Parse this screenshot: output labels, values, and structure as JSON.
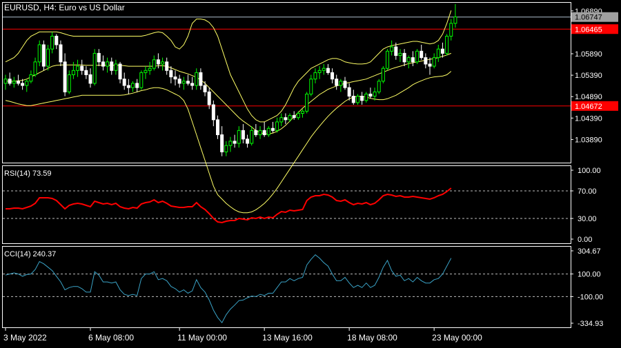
{
  "header": {
    "symbol_info": "EURUSD, H4:  Euro vs US Dollar"
  },
  "panels": {
    "rsi_label": "RSI(14) 73.59",
    "cci_label": "CCI(14) 240.37"
  },
  "price_axis": {
    "ticks": [
      "1.06890",
      "1.05890",
      "1.05390",
      "1.04890",
      "1.04390",
      "1.03890"
    ],
    "tick_values": [
      1.0689,
      1.0589,
      1.0539,
      1.0489,
      1.0439,
      1.0389
    ],
    "range": [
      1.0335,
      1.0708
    ],
    "current_price_label": "1.06747",
    "current_price": 1.06747,
    "line1_label": "1.06465",
    "line1_value": 1.06465,
    "line2_label": "1.04672",
    "line2_value": 1.04672
  },
  "rsi_axis": {
    "ticks": [
      "100.00",
      "70.00",
      "30.00",
      "0.00"
    ],
    "tick_values": [
      100,
      70,
      30,
      0
    ],
    "dashed_levels": [
      70,
      30
    ]
  },
  "cci_axis": {
    "ticks": [
      "304.67",
      "100.00",
      "-100.00",
      "-334.93"
    ],
    "tick_values": [
      304.67,
      100,
      -100,
      -334.93
    ],
    "dashed_levels": [
      100,
      -100
    ]
  },
  "time_axis": {
    "labels": [
      "3 May 2022",
      "6 May 08:00",
      "11 May 00:00",
      "13 May 16:00",
      "18 May 08:00",
      "23 May 00:00"
    ],
    "label_bar_index": [
      0,
      20,
      41,
      61,
      81,
      101
    ]
  },
  "colors": {
    "background": "#000000",
    "grid_border": "#ffffff",
    "bull_candle": "#00ff00",
    "bear_candle": "#ffffff",
    "bollinger": "#ffff66",
    "rsi_line": "#ff0000",
    "cci_line": "#3aa3c7",
    "hline": "#ff0000",
    "price_tag": "#ff0000",
    "current_tag": "#a0a0a0",
    "bid_line": "#b0c0d0"
  },
  "chart_data": {
    "type": "candlestick",
    "symbol": "EURUSD",
    "timeframe": "H4",
    "candles": [
      [
        1.052,
        1.054,
        1.0505,
        1.053
      ],
      [
        1.053,
        1.0545,
        1.0515,
        1.052
      ],
      [
        1.052,
        1.0535,
        1.051,
        1.0525
      ],
      [
        1.0525,
        1.054,
        1.0515,
        1.052
      ],
      [
        1.052,
        1.053,
        1.0505,
        1.0515
      ],
      [
        1.0515,
        1.053,
        1.05,
        1.0525
      ],
      [
        1.0525,
        1.055,
        1.052,
        1.054
      ],
      [
        1.054,
        1.058,
        1.0535,
        1.057
      ],
      [
        1.057,
        1.062,
        1.056,
        1.061
      ],
      [
        1.061,
        1.062,
        1.055,
        1.056
      ],
      [
        1.056,
        1.061,
        1.055,
        1.06
      ],
      [
        1.06,
        1.064,
        1.059,
        1.063
      ],
      [
        1.063,
        1.0635,
        1.06,
        1.061
      ],
      [
        1.061,
        1.062,
        1.056,
        1.057
      ],
      [
        1.057,
        1.059,
        1.049,
        1.05
      ],
      [
        1.05,
        1.055,
        1.0495,
        1.054
      ],
      [
        1.054,
        1.057,
        1.053,
        1.055
      ],
      [
        1.055,
        1.0575,
        1.0535,
        1.056
      ],
      [
        1.056,
        1.0575,
        1.054,
        1.055
      ],
      [
        1.055,
        1.056,
        1.053,
        1.054
      ],
      [
        1.054,
        1.0555,
        1.051,
        1.052
      ],
      [
        1.052,
        1.06,
        1.0515,
        1.059
      ],
      [
        1.059,
        1.06,
        1.056,
        1.057
      ],
      [
        1.057,
        1.0585,
        1.055,
        1.056
      ],
      [
        1.056,
        1.058,
        1.0545,
        1.057
      ],
      [
        1.057,
        1.058,
        1.054,
        1.055
      ],
      [
        1.055,
        1.0575,
        1.054,
        1.0565
      ],
      [
        1.0565,
        1.057,
        1.052,
        1.053
      ],
      [
        1.053,
        1.0545,
        1.0505,
        1.0515
      ],
      [
        1.0515,
        1.053,
        1.0495,
        1.051
      ],
      [
        1.051,
        1.0525,
        1.05,
        1.052
      ],
      [
        1.052,
        1.053,
        1.05,
        1.051
      ],
      [
        1.051,
        1.055,
        1.0505,
        1.0545
      ],
      [
        1.0545,
        1.056,
        1.053,
        1.055
      ],
      [
        1.055,
        1.057,
        1.054,
        1.0555
      ],
      [
        1.0555,
        1.0585,
        1.055,
        1.0575
      ],
      [
        1.0575,
        1.059,
        1.0555,
        1.0565
      ],
      [
        1.0565,
        1.058,
        1.055,
        1.057
      ],
      [
        1.057,
        1.058,
        1.054,
        1.055
      ],
      [
        1.055,
        1.056,
        1.052,
        1.0535
      ],
      [
        1.0535,
        1.055,
        1.0515,
        1.053
      ],
      [
        1.053,
        1.054,
        1.051,
        1.052
      ],
      [
        1.052,
        1.0535,
        1.0505,
        1.0525
      ],
      [
        1.0525,
        1.054,
        1.0515,
        1.052
      ],
      [
        1.052,
        1.0535,
        1.0505,
        1.0515
      ],
      [
        1.0515,
        1.0555,
        1.0505,
        1.0545
      ],
      [
        1.0545,
        1.0555,
        1.0505,
        1.0515
      ],
      [
        1.0515,
        1.0525,
        1.049,
        1.05
      ],
      [
        1.05,
        1.051,
        1.046,
        1.047
      ],
      [
        1.047,
        1.048,
        1.042,
        1.0435
      ],
      [
        1.0435,
        1.0445,
        1.039,
        1.04
      ],
      [
        1.04,
        1.042,
        1.035,
        1.036
      ],
      [
        1.036,
        1.0385,
        1.035,
        1.0375
      ],
      [
        1.0375,
        1.0395,
        1.036,
        1.0385
      ],
      [
        1.0385,
        1.04,
        1.037,
        1.038
      ],
      [
        1.038,
        1.042,
        1.037,
        1.041
      ],
      [
        1.041,
        1.0425,
        1.038,
        1.039
      ],
      [
        1.039,
        1.04,
        1.037,
        1.038
      ],
      [
        1.038,
        1.042,
        1.0375,
        1.041
      ],
      [
        1.041,
        1.0425,
        1.0395,
        1.04
      ],
      [
        1.04,
        1.042,
        1.039,
        1.041
      ],
      [
        1.041,
        1.043,
        1.0395,
        1.04
      ],
      [
        1.04,
        1.042,
        1.0395,
        1.0415
      ],
      [
        1.0415,
        1.043,
        1.0405,
        1.041
      ],
      [
        1.041,
        1.044,
        1.0405,
        1.043
      ],
      [
        1.043,
        1.045,
        1.042,
        1.044
      ],
      [
        1.044,
        1.045,
        1.0425,
        1.0435
      ],
      [
        1.0435,
        1.045,
        1.043,
        1.0445
      ],
      [
        1.0445,
        1.0455,
        1.0435,
        1.044
      ],
      [
        1.044,
        1.0455,
        1.0435,
        1.045
      ],
      [
        1.045,
        1.046,
        1.044,
        1.0455
      ],
      [
        1.0455,
        1.05,
        1.045,
        1.0495
      ],
      [
        1.0495,
        1.054,
        1.049,
        1.053
      ],
      [
        1.053,
        1.0555,
        1.052,
        1.0545
      ],
      [
        1.0545,
        1.056,
        1.053,
        1.055
      ],
      [
        1.055,
        1.0565,
        1.054,
        1.0555
      ],
      [
        1.0555,
        1.0565,
        1.054,
        1.0545
      ],
      [
        1.0545,
        1.0555,
        1.052,
        1.053
      ],
      [
        1.053,
        1.054,
        1.0505,
        1.0515
      ],
      [
        1.0515,
        1.053,
        1.05,
        1.0525
      ],
      [
        1.0525,
        1.0535,
        1.0505,
        1.051
      ],
      [
        1.051,
        1.052,
        1.048,
        1.049
      ],
      [
        1.049,
        1.0505,
        1.047,
        1.0475
      ],
      [
        1.0475,
        1.0495,
        1.047,
        1.049
      ],
      [
        1.049,
        1.05,
        1.047,
        1.048
      ],
      [
        1.048,
        1.05,
        1.0475,
        1.0495
      ],
      [
        1.0495,
        1.051,
        1.0485,
        1.049
      ],
      [
        1.049,
        1.051,
        1.048,
        1.05
      ],
      [
        1.05,
        1.053,
        1.0495,
        1.0525
      ],
      [
        1.0525,
        1.056,
        1.052,
        1.0555
      ],
      [
        1.0555,
        1.06,
        1.055,
        1.0595
      ],
      [
        1.0595,
        1.062,
        1.0585,
        1.0605
      ],
      [
        1.0605,
        1.0615,
        1.0575,
        1.0585
      ],
      [
        1.0585,
        1.06,
        1.057,
        1.059
      ],
      [
        1.059,
        1.06,
        1.056,
        1.057
      ],
      [
        1.057,
        1.0585,
        1.0555,
        1.058
      ],
      [
        1.058,
        1.0595,
        1.056,
        1.057
      ],
      [
        1.057,
        1.06,
        1.0565,
        1.0595
      ],
      [
        1.0595,
        1.061,
        1.0575,
        1.058
      ],
      [
        1.058,
        1.059,
        1.0555,
        1.0565
      ],
      [
        1.0565,
        1.058,
        1.054,
        1.056
      ],
      [
        1.056,
        1.059,
        1.0555,
        1.058
      ],
      [
        1.058,
        1.061,
        1.057,
        1.06
      ],
      [
        1.06,
        1.0615,
        1.058,
        1.059
      ],
      [
        1.059,
        1.0635,
        1.0585,
        1.063
      ],
      [
        1.063,
        1.067,
        1.062,
        1.066
      ],
      [
        1.066,
        1.0705,
        1.065,
        1.0675
      ]
    ],
    "bollinger": {
      "upper": [
        1.057,
        1.0575,
        1.058,
        1.059,
        1.0605,
        1.062,
        1.063,
        1.0635,
        1.064,
        1.064,
        1.064,
        1.064,
        1.064,
        1.0638,
        1.0635,
        1.0632,
        1.063,
        1.063,
        1.063,
        1.063,
        1.063,
        1.063,
        1.063,
        1.063,
        1.063,
        1.063,
        1.063,
        1.063,
        1.063,
        1.063,
        1.063,
        1.063,
        1.063,
        1.0632,
        1.0635,
        1.0638,
        1.064,
        1.0638,
        1.063,
        1.062,
        1.0605,
        1.06,
        1.061,
        1.063,
        1.066,
        1.067,
        1.067,
        1.0668,
        1.0662,
        1.065,
        1.063,
        1.06,
        1.057,
        1.054,
        1.052,
        1.05,
        1.048,
        1.046,
        1.0445,
        1.0435,
        1.043,
        1.043,
        1.0435,
        1.044,
        1.0445,
        1.0455,
        1.047,
        1.049,
        1.051,
        1.0525,
        1.0535,
        1.0545,
        1.0555,
        1.056,
        1.0565,
        1.057,
        1.0575,
        1.0578,
        1.0578,
        1.0575,
        1.057,
        1.0568,
        1.0566,
        1.0565,
        1.0565,
        1.0566,
        1.057,
        1.058,
        1.059,
        1.06,
        1.0605,
        1.0608,
        1.061,
        1.0612,
        1.0614,
        1.0616,
        1.0618,
        1.0618,
        1.0616,
        1.0614,
        1.0612,
        1.0614,
        1.062,
        1.0635,
        1.066,
        1.069
      ],
      "middle": [
        1.0525,
        1.0525,
        1.0525,
        1.0526,
        1.0527,
        1.053,
        1.0535,
        1.054,
        1.0545,
        1.055,
        1.0555,
        1.056,
        1.0562,
        1.0563,
        1.0563,
        1.0563,
        1.0563,
        1.0563,
        1.0563,
        1.0562,
        1.0562,
        1.0562,
        1.0562,
        1.0562,
        1.0562,
        1.0562,
        1.0562,
        1.0562,
        1.0561,
        1.056,
        1.056,
        1.056,
        1.056,
        1.056,
        1.056,
        1.056,
        1.0561,
        1.0561,
        1.056,
        1.0556,
        1.0552,
        1.0548,
        1.0545,
        1.0542,
        1.0538,
        1.0534,
        1.0528,
        1.052,
        1.051,
        1.05,
        1.049,
        1.048,
        1.047,
        1.046,
        1.045,
        1.044,
        1.0432,
        1.0425,
        1.0418,
        1.041,
        1.0405,
        1.0402,
        1.0402,
        1.0404,
        1.0408,
        1.0414,
        1.0422,
        1.0432,
        1.0442,
        1.0452,
        1.0462,
        1.047,
        1.0478,
        1.0486,
        1.0494,
        1.05,
        1.0506,
        1.051,
        1.0514,
        1.0517,
        1.052,
        1.0522,
        1.0524,
        1.0526,
        1.0528,
        1.053,
        1.0534,
        1.0538,
        1.0542,
        1.0546,
        1.055,
        1.0554,
        1.0557,
        1.056,
        1.0563,
        1.0566,
        1.0568,
        1.057,
        1.0572,
        1.0574,
        1.0576,
        1.0578,
        1.058,
        1.0583,
        1.0586,
        1.059
      ],
      "lower": [
        1.048,
        1.0478,
        1.0475,
        1.0472,
        1.047,
        1.0468,
        1.0468,
        1.047,
        1.0472,
        1.0474,
        1.0476,
        1.0478,
        1.048,
        1.0482,
        1.0484,
        1.0486,
        1.0488,
        1.049,
        1.0492,
        1.0492,
        1.0492,
        1.0492,
        1.0492,
        1.0492,
        1.0492,
        1.0492,
        1.0492,
        1.0492,
        1.0493,
        1.0495,
        1.0497,
        1.05,
        1.0503,
        1.0505,
        1.0508,
        1.051,
        1.051,
        1.0508,
        1.0505,
        1.05,
        1.0495,
        1.049,
        1.048,
        1.046,
        1.043,
        1.04,
        1.037,
        1.034,
        1.031,
        1.028,
        1.026,
        1.025,
        1.024,
        1.0232,
        1.0225,
        1.022,
        1.0218,
        1.0218,
        1.022,
        1.0225,
        1.0232,
        1.024,
        1.025,
        1.0262,
        1.0275,
        1.029,
        1.0305,
        1.032,
        1.0335,
        1.035,
        1.0365,
        1.038,
        1.0395,
        1.0408,
        1.042,
        1.0432,
        1.0443,
        1.0453,
        1.0462,
        1.047,
        1.0478,
        1.0484,
        1.0488,
        1.049,
        1.049,
        1.0488,
        1.0485,
        1.0483,
        1.0482,
        1.0482,
        1.0484,
        1.0488,
        1.0492,
        1.0498,
        1.0504,
        1.051,
        1.0517,
        1.0522,
        1.0526,
        1.053,
        1.0533,
        1.0535,
        1.0536,
        1.0537,
        1.054,
        1.0548
      ]
    },
    "rsi": [
      44,
      44,
      45,
      45,
      44,
      46,
      48,
      52,
      60,
      60,
      60,
      59,
      56,
      50,
      44,
      49,
      51,
      52,
      51,
      49,
      47,
      55,
      53,
      51,
      52,
      50,
      52,
      47,
      45,
      44,
      46,
      45,
      51,
      53,
      54,
      57,
      53,
      55,
      52,
      48,
      47,
      46,
      46,
      47,
      47,
      53,
      47,
      43,
      37,
      30,
      25,
      24,
      26,
      27,
      27,
      30,
      29,
      28,
      31,
      30,
      32,
      30,
      32,
      31,
      36,
      40,
      39,
      42,
      41,
      42,
      43,
      56,
      61,
      63,
      63,
      65,
      64,
      61,
      56,
      55,
      57,
      53,
      50,
      52,
      51,
      53,
      50,
      52,
      57,
      63,
      65,
      64,
      62,
      63,
      61,
      61,
      62,
      61,
      60,
      59,
      58,
      60,
      63,
      65,
      69,
      74
    ],
    "cci": [
      90,
      100,
      110,
      100,
      80,
      95,
      100,
      140,
      210,
      190,
      160,
      130,
      80,
      30,
      -40,
      -20,
      -10,
      -10,
      -30,
      -60,
      -60,
      120,
      90,
      30,
      30,
      20,
      30,
      -40,
      -80,
      -90,
      -80,
      -90,
      60,
      100,
      100,
      120,
      50,
      60,
      40,
      -10,
      -30,
      -60,
      -40,
      -70,
      -50,
      50,
      -20,
      -60,
      -130,
      -220,
      -285,
      -330,
      -260,
      -210,
      -175,
      -135,
      -130,
      -110,
      -95,
      -100,
      -80,
      -90,
      -70,
      -70,
      -20,
      30,
      30,
      60,
      40,
      60,
      70,
      180,
      230,
      270,
      240,
      200,
      170,
      100,
      40,
      40,
      70,
      20,
      -20,
      0,
      -20,
      20,
      -20,
      0,
      70,
      160,
      220,
      130,
      80,
      90,
      40,
      60,
      30,
      70,
      40,
      20,
      20,
      50,
      60,
      100,
      170,
      240
    ]
  }
}
